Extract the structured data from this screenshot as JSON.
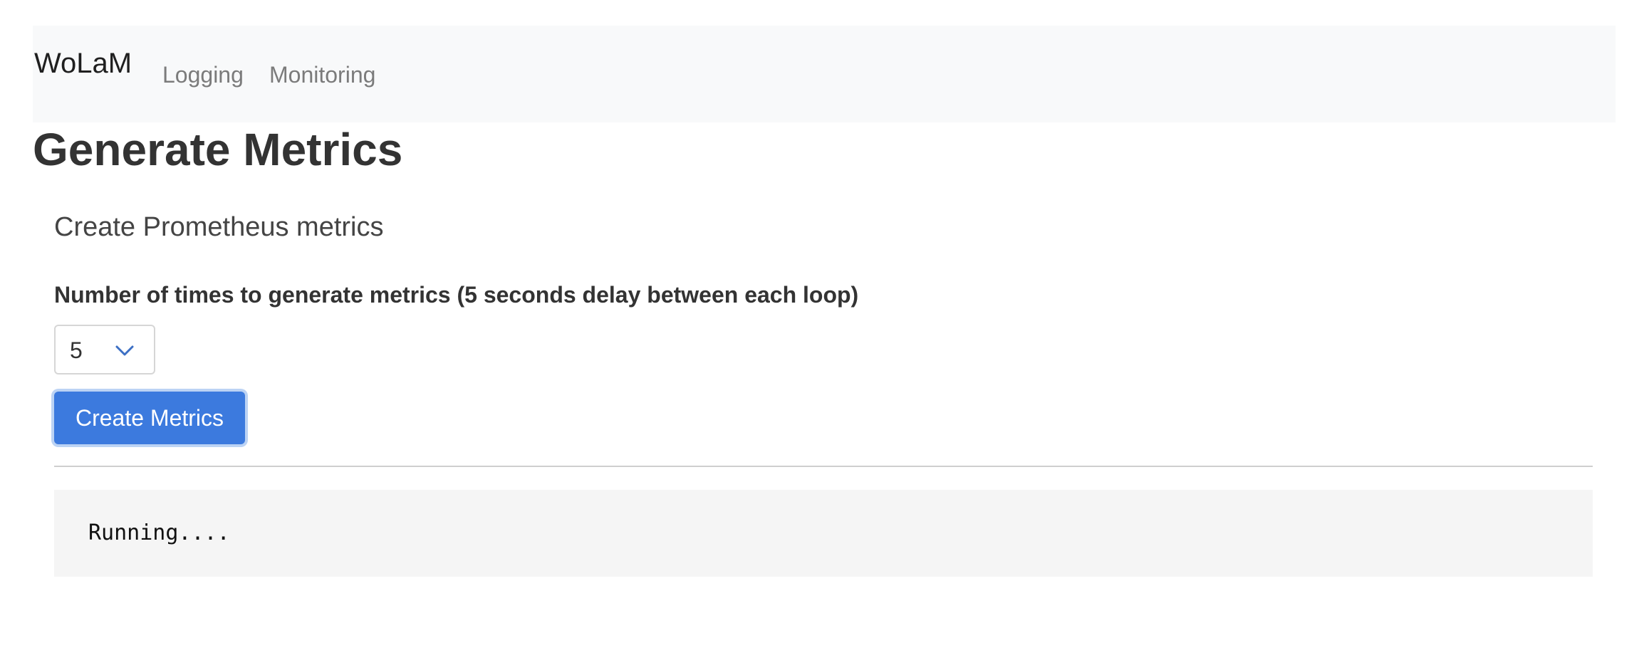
{
  "navbar": {
    "brand": "WoLaM",
    "links": [
      {
        "label": "Logging"
      },
      {
        "label": "Monitoring"
      }
    ]
  },
  "page": {
    "title": "Generate Metrics"
  },
  "section": {
    "title": "Create Prometheus metrics"
  },
  "form": {
    "label": "Number of times to generate metrics (5 seconds delay between each loop)",
    "select": {
      "selected": "5",
      "icon": "chevron-down-icon"
    },
    "button_label": "Create Metrics"
  },
  "output": {
    "text": "Running...."
  },
  "colors": {
    "navbar_bg": "#f8f9fa",
    "primary": "#3c7ade",
    "output_bg": "#f5f5f5"
  }
}
